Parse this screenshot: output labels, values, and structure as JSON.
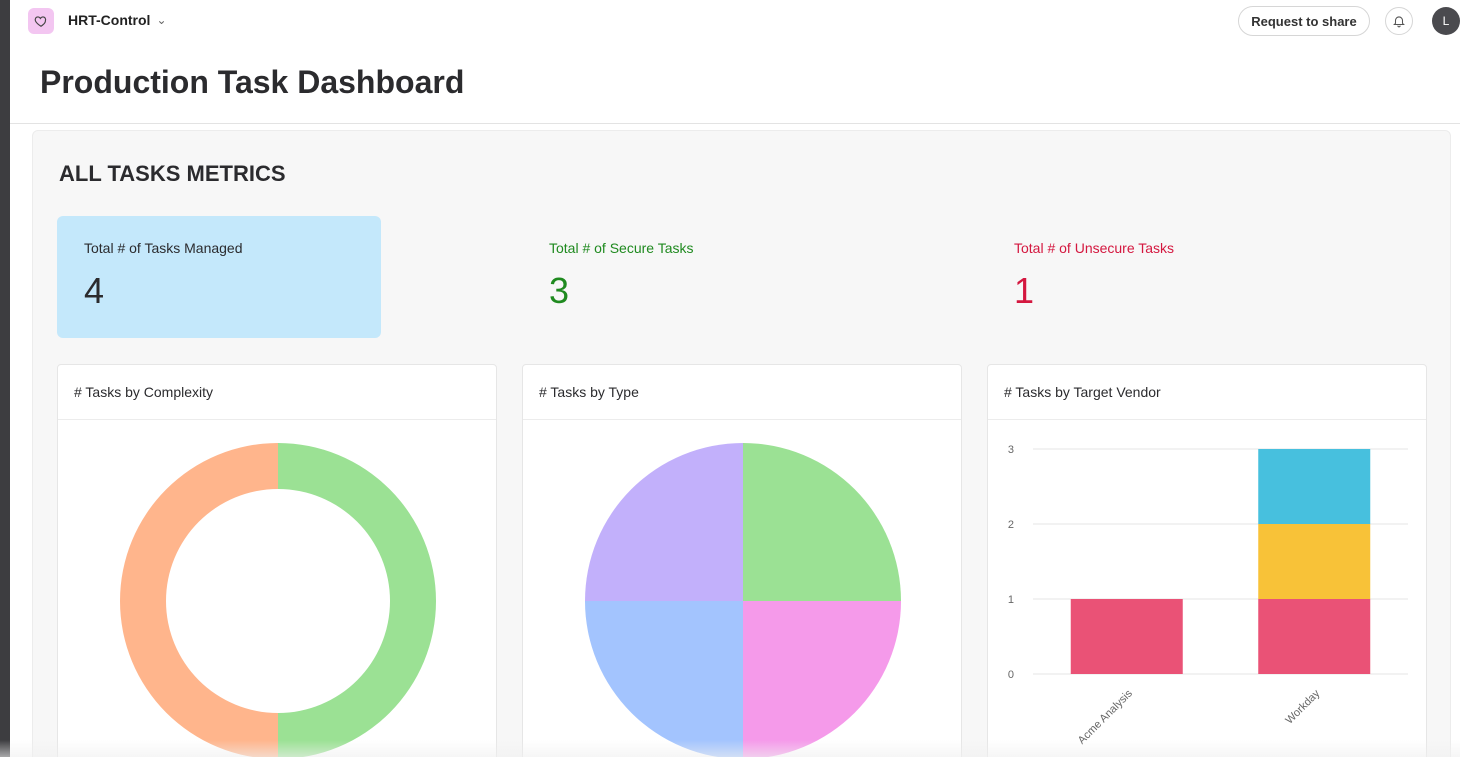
{
  "app": {
    "name": "HRT-Control",
    "icon": "heart-icon"
  },
  "header": {
    "share_label": "Request to share",
    "notification_icon": "bell-icon",
    "avatar_initial": "L"
  },
  "page": {
    "title": "Production Task Dashboard"
  },
  "section": {
    "title": "ALL TASKS METRICS"
  },
  "metrics": [
    {
      "label": "Total # of Tasks Managed",
      "value": "4",
      "color": "#2b2b2e",
      "background": "#c4e8fb"
    },
    {
      "label": "Total # of Secure Tasks",
      "value": "3",
      "color": "#1f8a1f"
    },
    {
      "label": "Total # of Unsecure Tasks",
      "value": "1",
      "color": "#d4173f"
    }
  ],
  "cards": [
    {
      "title": "# Tasks by Complexity"
    },
    {
      "title": "# Tasks by Type"
    },
    {
      "title": "# Tasks by Target Vendor"
    }
  ],
  "chart_data": [
    {
      "type": "pie",
      "variant": "donut",
      "slices": [
        {
          "value": 2,
          "color": "#9be194"
        },
        {
          "value": 2,
          "color": "#ffb58c"
        }
      ]
    },
    {
      "type": "pie",
      "slices": [
        {
          "value": 1,
          "color": "#9be194"
        },
        {
          "value": 1,
          "color": "#f59aea"
        },
        {
          "value": 1,
          "color": "#a3c4fe"
        },
        {
          "value": 1,
          "color": "#c2b0fb"
        }
      ]
    },
    {
      "type": "bar",
      "stacked": true,
      "categories": [
        "Acme Analysis",
        "Workday"
      ],
      "series": [
        {
          "values": [
            1,
            1
          ],
          "color": "#ea5276"
        },
        {
          "values": [
            0,
            1
          ],
          "color": "#f8c238"
        },
        {
          "values": [
            0,
            1
          ],
          "color": "#47c0de"
        }
      ],
      "yticks": [
        "0",
        "1",
        "2",
        "3"
      ],
      "ylim": [
        0,
        3
      ],
      "grid": true
    }
  ]
}
